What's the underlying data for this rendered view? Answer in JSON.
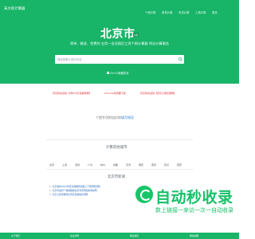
{
  "header": {
    "logo": "朱大的计算器",
    "nav": [
      "个税计算",
      "房贷计算",
      "车贷计算",
      "工资计算",
      "更多"
    ]
  },
  "hero": {
    "city": "北京市",
    "badge": "切换",
    "tagline": "简单、精准、免费的 五险一金及税后工资个税计算器 将这计算服务",
    "search_placeholder": "搜索想要计算的内容...",
    "shortcut": "Ctrl+D收藏本页"
  },
  "ads": [
    "京东秒杀活动【3件8.8元包邮特惠】",
    "Chrome浏览器下载",
    "京东秒杀活动【京东大促优惠券】"
  ],
  "favorites": {
    "text": "个税专项附加扣除",
    "link": "填写指导"
  },
  "sections": {
    "other_cities": "计算其他城市",
    "news": "北京市新闻"
  },
  "cities": [
    "北京",
    "上海",
    "深圳",
    "广州",
    "杭州",
    "成都",
    "天津",
    "重庆",
    "南京",
    "武汉",
    "西安"
  ],
  "news": [
    "北京发布2024年度社保缴费基数上下限调整通知",
    "北京市最新个税政策解读及专项附加扣除说明",
    "北京公积金缴存比例及基数最新调整"
  ],
  "watermark": {
    "title": "自动秒收录",
    "subtitle": "数上链接一来访一次一自动收录"
  },
  "footer": [
    "关于我们",
    "免责声明",
    "联系我们",
    "网站地图"
  ],
  "colors": {
    "brand": "#18b468",
    "link": "#2b88d9",
    "alert": "#e4222f"
  }
}
